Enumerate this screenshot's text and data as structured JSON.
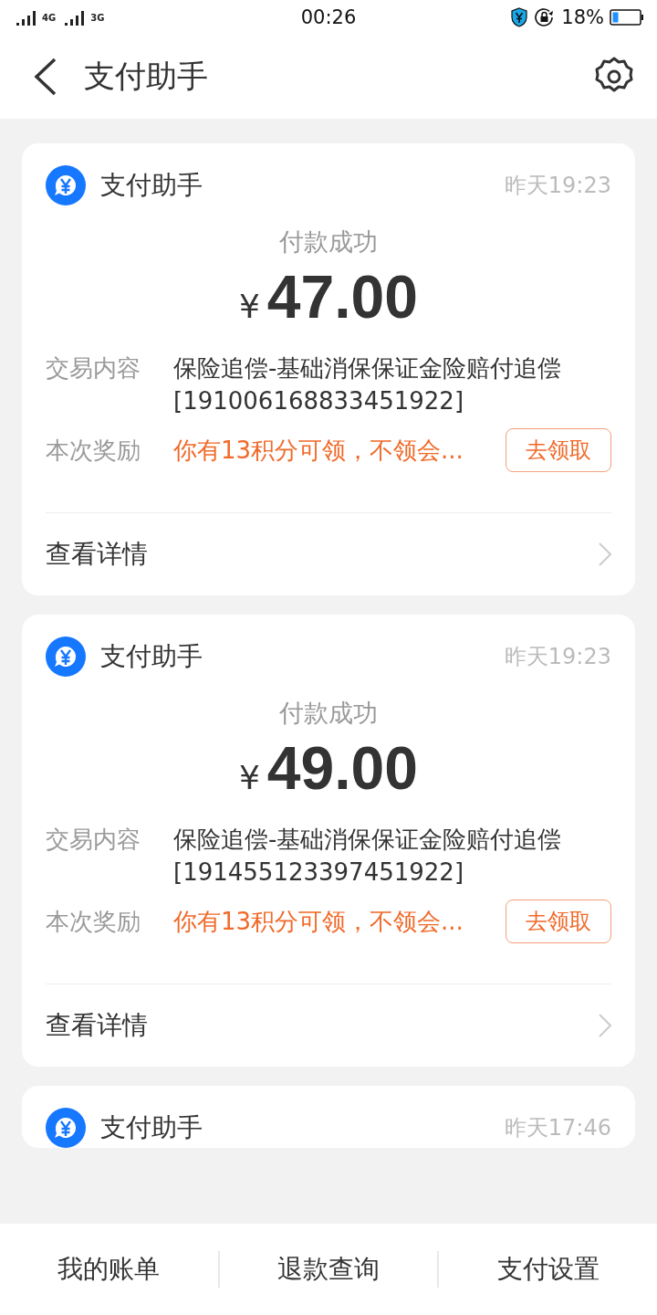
{
  "status_bar": {
    "network_1": "4G",
    "network_2": "3G",
    "time": "00:26",
    "battery": "18%"
  },
  "nav": {
    "title": "支付助手"
  },
  "messages": [
    {
      "sender": "支付助手",
      "time": "昨天19:23",
      "status": "付款成功",
      "currency": "¥",
      "amount": "47.00",
      "rows": [
        {
          "kind": "text",
          "label": "交易内容",
          "value": "保险追偿-基础消保保证金险赔付追偿 [191006168833451922]"
        },
        {
          "kind": "reward",
          "label": "本次奖励",
          "value": "你有13积分可领，不领会...",
          "action": "去领取"
        }
      ],
      "link": "查看详情"
    },
    {
      "sender": "支付助手",
      "time": "昨天19:23",
      "status": "付款成功",
      "currency": "¥",
      "amount": "49.00",
      "rows": [
        {
          "kind": "text",
          "label": "交易内容",
          "value": "保险追偿-基础消保保证金险赔付追偿 [191455123397451922]"
        },
        {
          "kind": "reward",
          "label": "本次奖励",
          "value": "你有13积分可领，不领会...",
          "action": "去领取"
        }
      ],
      "link": "查看详情"
    },
    {
      "sender": "支付助手",
      "time": "昨天17:46"
    }
  ],
  "bottom_tabs": [
    "我的账单",
    "退款查询",
    "支付设置"
  ]
}
